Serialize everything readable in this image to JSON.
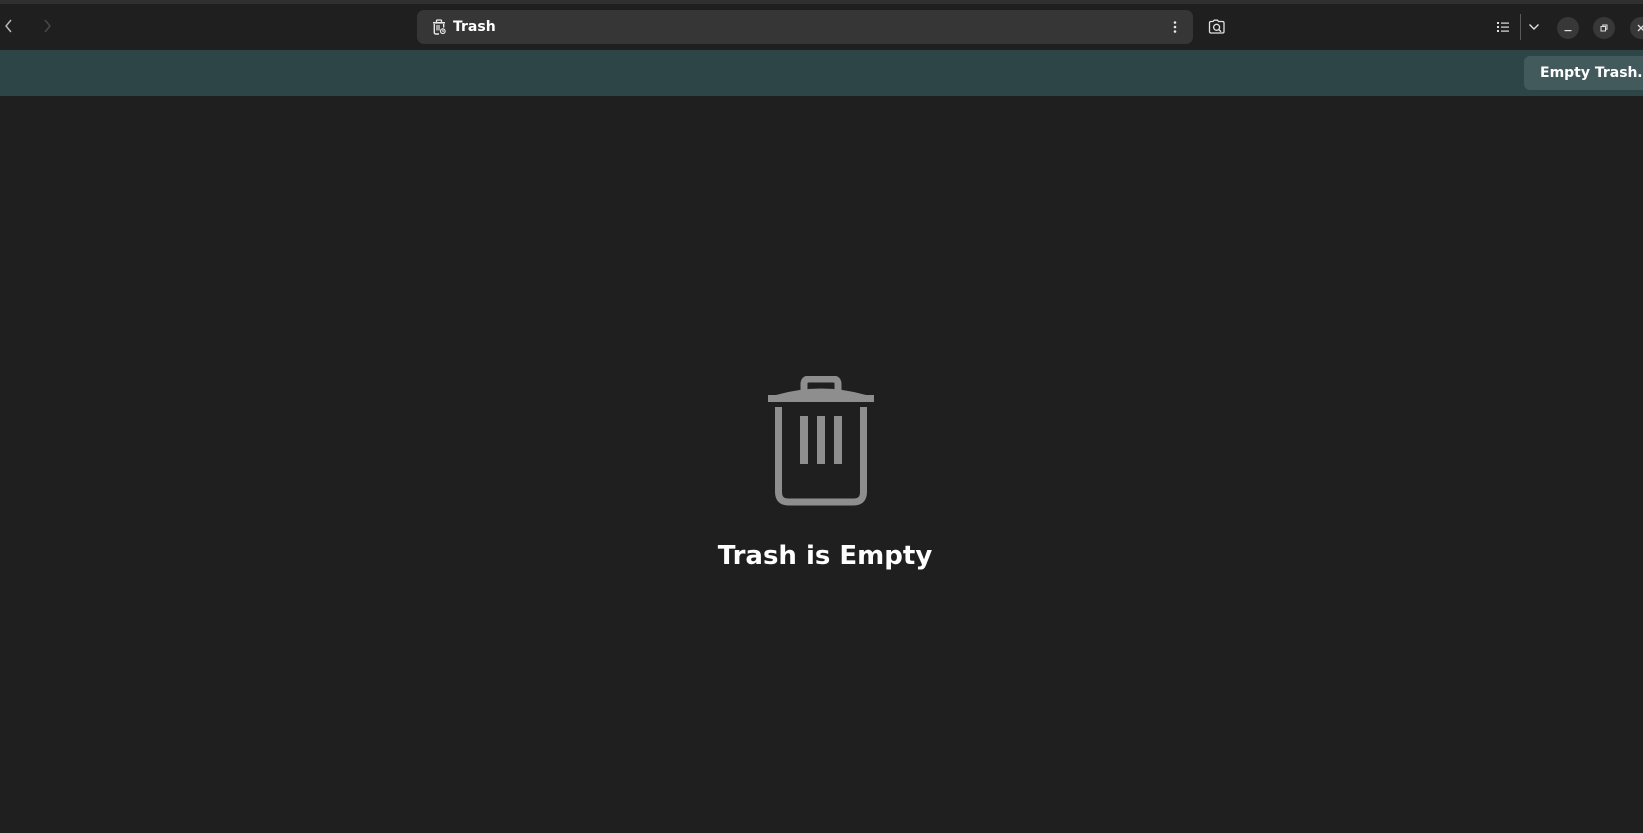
{
  "header": {
    "back_icon": "go-previous-icon",
    "forward_icon": "go-next-icon",
    "path": {
      "icon": "trash-icon",
      "label": "Trash",
      "menu_icon": "view-more-vertical-icon"
    },
    "search_icon": "search-folder-icon",
    "view_icon": "list-view-icon",
    "view_dropdown_icon": "chevron-down-icon",
    "window_controls": {
      "minimize_icon": "minimize-icon",
      "maximize_icon": "restore-icon",
      "close_icon": "close-icon"
    }
  },
  "infobar": {
    "empty_trash_label": "Empty Trash…"
  },
  "status": {
    "icon": "trash-icon",
    "title": "Trash is Empty"
  },
  "colors": {
    "window_bg": "#1f1f1f",
    "pathbar_bg": "#363636",
    "infobar_bg": "#2e4548",
    "infobar_button_bg": "#435a5d",
    "status_icon": "#8e8e8e",
    "text": "#ffffff"
  }
}
